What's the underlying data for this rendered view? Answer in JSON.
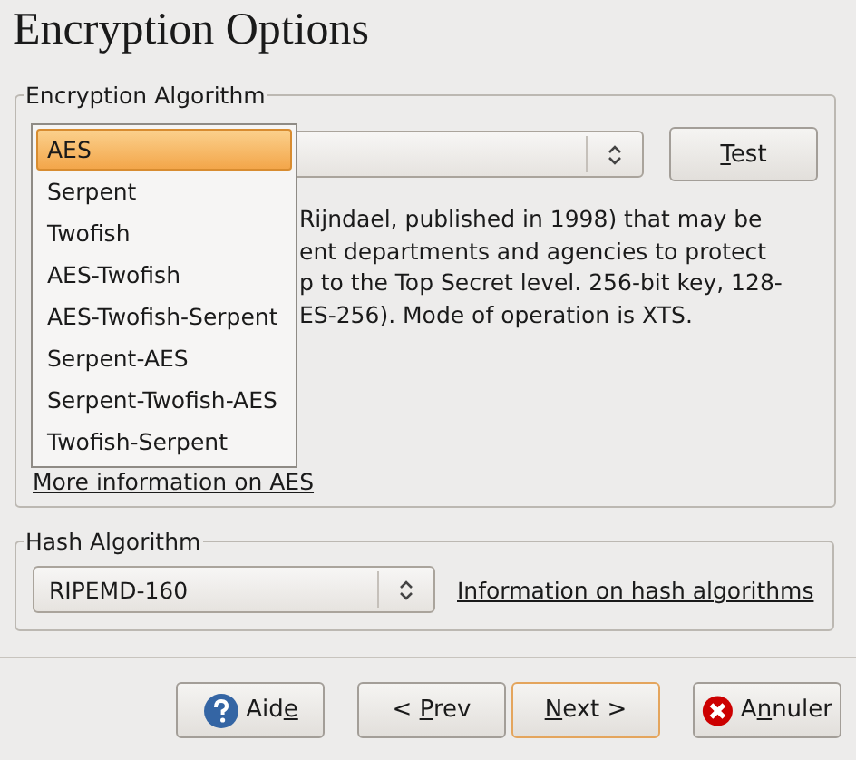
{
  "title": "Encryption Options",
  "encryption": {
    "legend": "Encryption Algorithm",
    "test_button": {
      "key": "T",
      "after": "est"
    },
    "popup_items": [
      {
        "label": "AES",
        "selected": true
      },
      {
        "label": "Serpent",
        "selected": false
      },
      {
        "label": "Twofish",
        "selected": false
      },
      {
        "label": "AES-Twofish",
        "selected": false
      },
      {
        "label": "AES-Twofish-Serpent",
        "selected": false
      },
      {
        "label": "Serpent-AES",
        "selected": false
      },
      {
        "label": "Serpent-Twofish-AES",
        "selected": false
      },
      {
        "label": "Twofish-Serpent",
        "selected": false
      }
    ],
    "description_lines": [
      "Rijndael, published in 1998) that may be",
      "ent departments and agencies to protect",
      "p to the Top Secret level. 256-bit key, 128-",
      "ES-256). Mode of operation is XTS."
    ],
    "more_info_link": "More information on AES"
  },
  "hash": {
    "legend": "Hash Algorithm",
    "value": "RIPEMD-160",
    "info_link": "Information on hash algorithms"
  },
  "buttons": [
    {
      "kind": "help",
      "key": "e",
      "before": "Aid",
      "focused": false
    },
    {
      "kind": "plain",
      "before": "< ",
      "key": "P",
      "after": "rev",
      "focused": false
    },
    {
      "kind": "plain",
      "key": "N",
      "after": "ext >",
      "focused": true
    },
    {
      "kind": "cancel",
      "before": "A",
      "key": "n",
      "after": "nuler",
      "focused": false
    }
  ]
}
